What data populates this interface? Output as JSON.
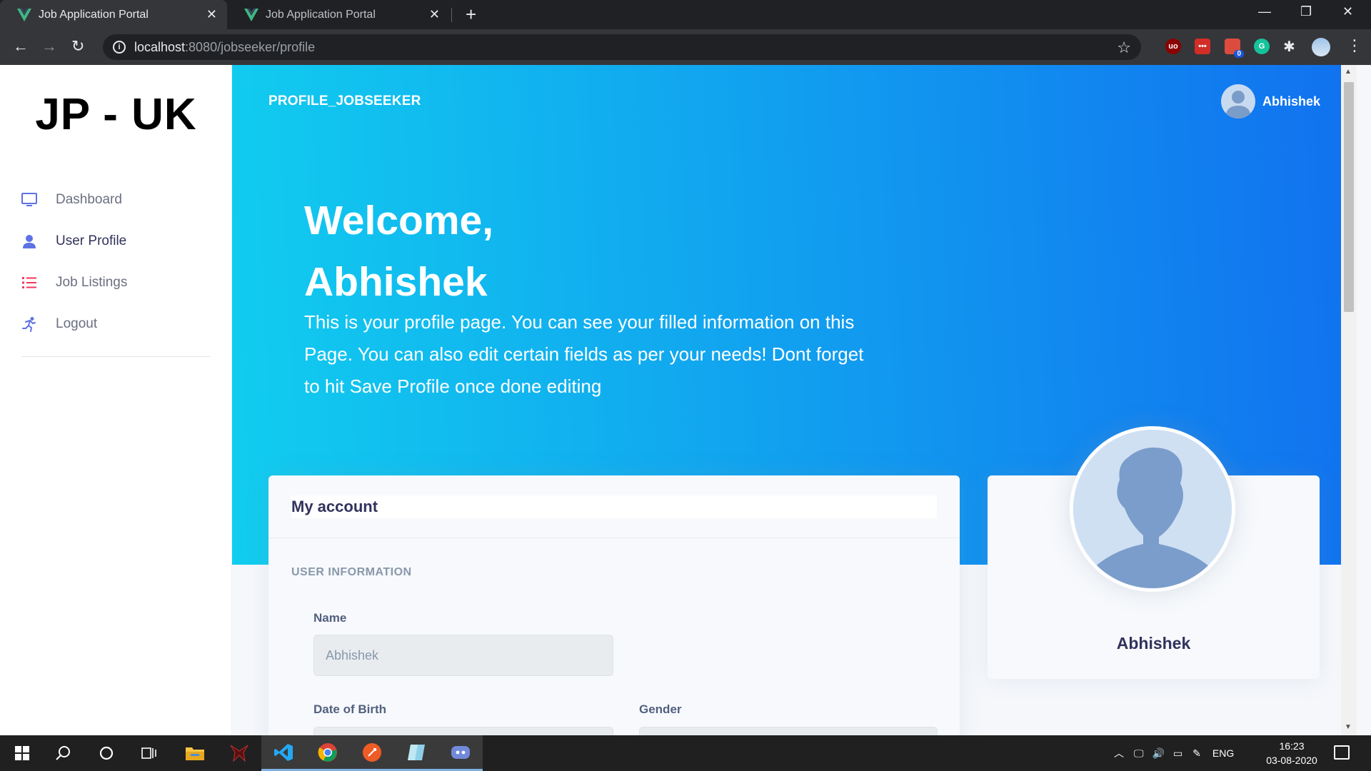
{
  "browser": {
    "tabs": [
      {
        "title": "Job Application Portal",
        "active": true
      },
      {
        "title": "Job Application Portal",
        "active": false
      }
    ],
    "url_host": "localhost",
    "url_path": ":8080/jobseeker/profile",
    "extensions": [
      {
        "name": "ublock-icon",
        "label": "uo",
        "color": "#8b0000"
      },
      {
        "name": "lastpass-icon",
        "label": "•••",
        "color": "#d32d27"
      },
      {
        "name": "todoist-icon",
        "label": "0",
        "color": "#db4c3f"
      },
      {
        "name": "grammarly-icon",
        "label": "G",
        "color": "#15c39a"
      }
    ]
  },
  "sidebar": {
    "brand": "JP - UK",
    "items": [
      {
        "label": "Dashboard",
        "icon": "monitor-icon",
        "color": "#5e72e4"
      },
      {
        "label": "User Profile",
        "icon": "user-icon",
        "color": "#5e72e4"
      },
      {
        "label": "Job Listings",
        "icon": "list-icon",
        "color": "#f5365c"
      },
      {
        "label": "Logout",
        "icon": "running-icon",
        "color": "#5e72e4"
      }
    ]
  },
  "header": {
    "title": "PROFILE_JOBSEEKER",
    "user_name": "Abhishek"
  },
  "hero": {
    "greeting_line1": "Welcome,",
    "greeting_line2": "Abhishek",
    "description": "This is your profile page. You can see your filled information on this Page. You can also edit certain fields as per your needs! Dont forget to hit Save Profile once done editing"
  },
  "account": {
    "title": "My account",
    "section": "USER INFORMATION",
    "name_label": "Name",
    "name_placeholder": "Abhishek",
    "dob_label": "Date of Birth",
    "gender_label": "Gender"
  },
  "profile_card": {
    "name": "Abhishek"
  },
  "taskbar": {
    "apps": [
      "windows-start-icon",
      "search-icon",
      "cortana-icon",
      "task-view-icon",
      "file-explorer-icon",
      "predator-icon",
      "vscode-icon",
      "chrome-icon",
      "postman-icon",
      "app-icon",
      "discord-icon"
    ],
    "language": "ENG",
    "time": "16:23",
    "date": "03-08-2020"
  },
  "colors": {
    "hero_gradient_start": "#11cdef",
    "hero_gradient_end": "#1171ef",
    "primary_text": "#32325d"
  }
}
